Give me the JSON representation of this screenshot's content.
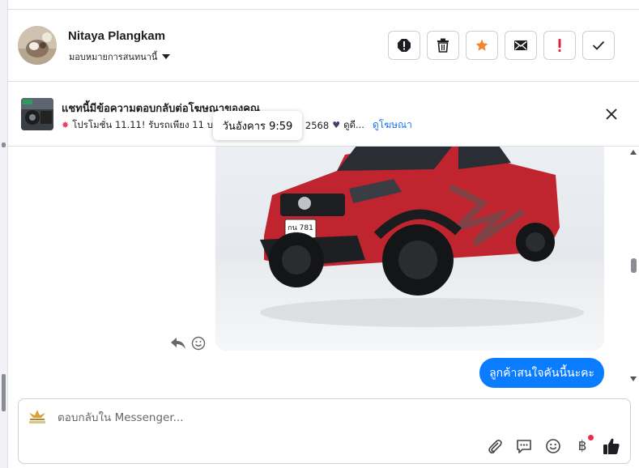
{
  "header": {
    "contact_name": "Nitaya Plangkam",
    "assign_label": "มอบหมายการสนทนานี้",
    "actions": [
      {
        "name": "report-icon",
        "color": "#1c1e21"
      },
      {
        "name": "trash-icon",
        "color": "#1c1e21"
      },
      {
        "name": "star-icon",
        "color": "#f0862e"
      },
      {
        "name": "envelope-icon",
        "color": "#1c1e21"
      },
      {
        "name": "exclamation-icon",
        "color": "#e41e3f"
      },
      {
        "name": "checkmark-icon",
        "color": "#1c1e21"
      }
    ]
  },
  "ad": {
    "title": "แชทนี้มีข้อความตอบกลับต่อโฆษณาของคุณ",
    "subtitle": "โปรโมชั่น 11.11! รับรถเพียง 11 บาท",
    "subtitle_tail": "2568",
    "subtitle_end": "ดูดี...",
    "link": "ดูโฆษณา",
    "tooltip": "วันอังคาร 9:59"
  },
  "chat": {
    "message_text": "ลูกค้าสนใจคันนี้นะคะ",
    "bubble_color": "#0a7cff",
    "plate": "กน 781"
  },
  "composer": {
    "placeholder": "ตอบกลับใน Messenger...",
    "currency_symbol": "฿"
  }
}
